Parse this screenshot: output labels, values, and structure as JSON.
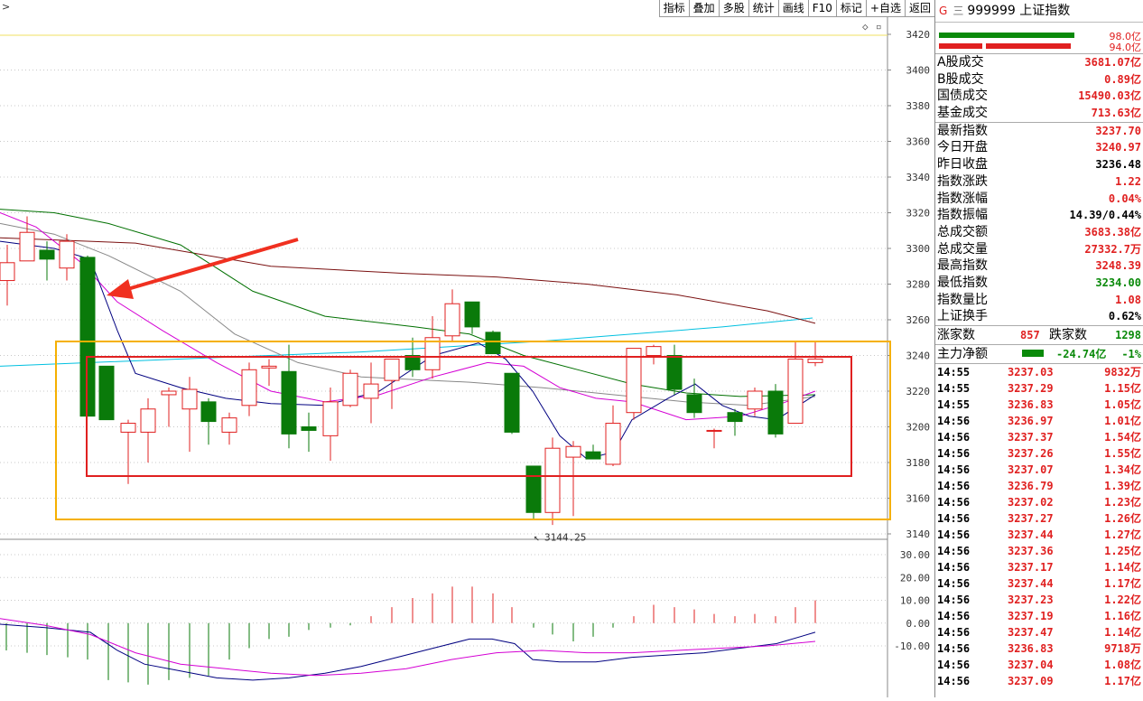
{
  "toolbar": {
    "arrow": ">",
    "buttons": [
      "指标",
      "叠加",
      "多股",
      "统计",
      "画线",
      "F10",
      "标记",
      "+自选",
      "返回"
    ]
  },
  "chart": {
    "price_axis_labels": [
      "3420",
      "3400",
      "3380",
      "3360",
      "3340",
      "3320",
      "3300",
      "3280",
      "3260",
      "3240",
      "3220",
      "3200",
      "3180",
      "3160",
      "3140"
    ],
    "osc_axis_labels": [
      "30.00",
      "20.00",
      "10.00",
      "0.00",
      "-10.00"
    ],
    "low_label": "3144.25",
    "corner_icons": [
      "◇",
      "▫"
    ],
    "colors": {
      "up": "#e02020",
      "down": "#0a7a0a",
      "ma5": "#000080",
      "ma10": "#d400d4",
      "ma20": "#888888",
      "ma60": "#007000",
      "ma120": "#7a1010",
      "ma250": "#00c0e0",
      "box_outer": "#f5b000",
      "box_inner": "#e02020",
      "arrow": "#f03020"
    }
  },
  "panel": {
    "title_prefix": "G",
    "title_icon": "三",
    "title": "999999 上证指数",
    "bar1_value": "98.0亿",
    "bar2_value": "94.0亿",
    "trade_rows": [
      {
        "k": "A股成交",
        "v": "3681.07亿",
        "c": "red"
      },
      {
        "k": "B股成交",
        "v": "0.89亿",
        "c": "red"
      },
      {
        "k": "国债成交",
        "v": "15490.03亿",
        "c": "red"
      },
      {
        "k": "基金成交",
        "v": "713.63亿",
        "c": "red"
      }
    ],
    "index_rows": [
      {
        "k": "最新指数",
        "v": "3237.70",
        "c": "red"
      },
      {
        "k": "今日开盘",
        "v": "3240.97",
        "c": "red"
      },
      {
        "k": "昨日收盘",
        "v": "3236.48",
        "c": "blk"
      },
      {
        "k": "指数涨跌",
        "v": "1.22",
        "c": "red"
      },
      {
        "k": "指数涨幅",
        "v": "0.04%",
        "c": "red"
      },
      {
        "k": "指数振幅",
        "v": "14.39/0.44%",
        "c": "blk"
      },
      {
        "k": "总成交额",
        "v": "3683.38亿",
        "c": "red"
      },
      {
        "k": "总成交量",
        "v": "27332.7万",
        "c": "red"
      },
      {
        "k": "最高指数",
        "v": "3248.39",
        "c": "red"
      },
      {
        "k": "最低指数",
        "v": "3234.00",
        "c": "grn"
      },
      {
        "k": "指数量比",
        "v": "1.08",
        "c": "red"
      },
      {
        "k": "上证换手",
        "v": "0.62%",
        "c": "blk"
      }
    ],
    "updown": {
      "up_label": "涨家数",
      "up_val": "857",
      "down_label": "跌家数",
      "down_val": "1298"
    },
    "netflow": {
      "label": "主力净额",
      "icon": "▤",
      "value": "-24.74亿",
      "pct": "-1%"
    },
    "ticks": [
      {
        "t": "14:55",
        "p": "3237.03",
        "a": "9832万"
      },
      {
        "t": "14:55",
        "p": "3237.29",
        "a": "1.15亿"
      },
      {
        "t": "14:55",
        "p": "3236.83",
        "a": "1.05亿"
      },
      {
        "t": "14:56",
        "p": "3236.97",
        "a": "1.01亿"
      },
      {
        "t": "14:56",
        "p": "3237.37",
        "a": "1.54亿"
      },
      {
        "t": "14:56",
        "p": "3237.26",
        "a": "1.55亿"
      },
      {
        "t": "14:56",
        "p": "3237.07",
        "a": "1.34亿"
      },
      {
        "t": "14:56",
        "p": "3236.79",
        "a": "1.39亿"
      },
      {
        "t": "14:56",
        "p": "3237.02",
        "a": "1.23亿"
      },
      {
        "t": "14:56",
        "p": "3237.27",
        "a": "1.26亿"
      },
      {
        "t": "14:56",
        "p": "3237.44",
        "a": "1.27亿"
      },
      {
        "t": "14:56",
        "p": "3237.36",
        "a": "1.25亿"
      },
      {
        "t": "14:56",
        "p": "3237.17",
        "a": "1.14亿"
      },
      {
        "t": "14:56",
        "p": "3237.44",
        "a": "1.17亿"
      },
      {
        "t": "14:56",
        "p": "3237.23",
        "a": "1.22亿"
      },
      {
        "t": "14:56",
        "p": "3237.19",
        "a": "1.16亿"
      },
      {
        "t": "14:56",
        "p": "3237.47",
        "a": "1.14亿"
      },
      {
        "t": "14:56",
        "p": "3236.83",
        "a": "9718万"
      },
      {
        "t": "14:56",
        "p": "3237.04",
        "a": "1.08亿"
      },
      {
        "t": "14:56",
        "p": "3237.09",
        "a": "1.17亿"
      }
    ]
  }
}
